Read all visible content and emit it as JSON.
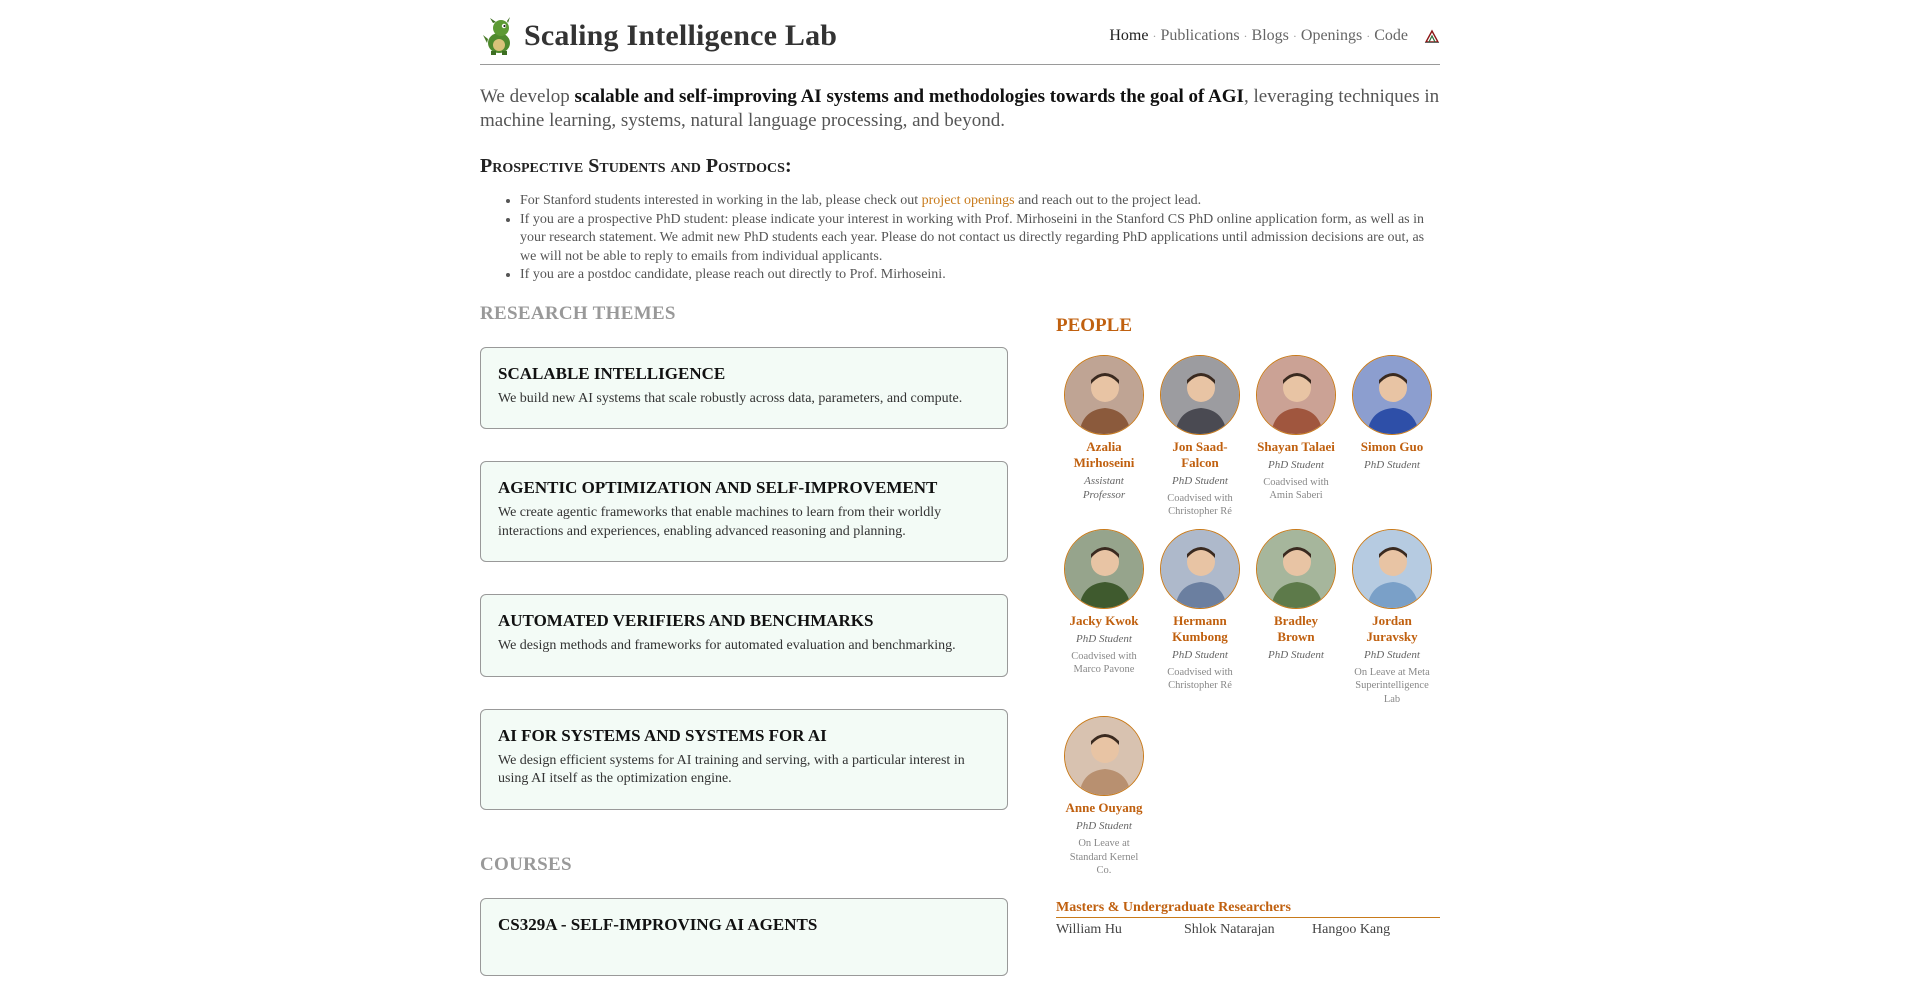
{
  "header": {
    "title": "Scaling Intelligence Lab",
    "logo_icon": "dragon-logo-icon",
    "nav": [
      {
        "label": "Home",
        "active": true
      },
      {
        "label": "Publications",
        "active": false
      },
      {
        "label": "Blogs",
        "active": false
      },
      {
        "label": "Openings",
        "active": false
      },
      {
        "label": "Code",
        "active": false
      }
    ],
    "nav_separator": "·",
    "nav_extra_icon": "stanford-tree-icon"
  },
  "intro": {
    "prefix": "We develop ",
    "emphasis": "scalable and self-improving AI systems and methodologies towards the goal of AGI",
    "suffix": ", leveraging techniques in machine learning, systems, natural language processing, and beyond."
  },
  "prospective": {
    "title": "Prospective Students and Postdocs:",
    "items": [
      {
        "before": "For Stanford students interested in working in the lab, please check out ",
        "link": "project openings",
        "after": " and reach out to the project lead."
      },
      {
        "text": "If you are a prospective PhD student: please indicate your interest in working with Prof. Mirhoseini in the Stanford CS PhD online application form, as well as in your research statement. We admit new PhD students each year. Please do not contact us directly regarding PhD applications until admission decisions are out, as we will not be able to reply to emails from individual applicants."
      },
      {
        "text": "If you are a postdoc candidate, please reach out directly to Prof. Mirhoseini."
      }
    ]
  },
  "research": {
    "heading": "Research Themes",
    "themes": [
      {
        "title": "Scalable Intelligence",
        "desc": "We build new AI systems that scale robustly across data, parameters, and compute."
      },
      {
        "title": "Agentic Optimization and Self-Improvement",
        "desc": "We create agentic frameworks that enable machines to learn from their worldly interactions and experiences, enabling advanced reasoning and planning."
      },
      {
        "title": "Automated Verifiers and Benchmarks",
        "desc": "We design methods and frameworks for automated evaluation and benchmarking."
      },
      {
        "title": "AI for Systems and Systems for AI",
        "desc": "We design efficient systems for AI training and serving, with a particular interest in using AI itself as the optimization engine."
      }
    ]
  },
  "courses": {
    "heading": "Courses",
    "items": [
      {
        "title": "CS329A - Self-Improving AI Agents"
      }
    ]
  },
  "people": {
    "heading": "People",
    "members": [
      {
        "name": "Azalia Mirhoseini",
        "role": "Assistant Professor",
        "note": "",
        "color": "#8b5a3c"
      },
      {
        "name": "Jon Saad-Falcon",
        "role": "PhD Student",
        "note": "Coadvised with Christopher Ré",
        "color": "#4a4a52"
      },
      {
        "name": "Shayan Talaei",
        "role": "PhD Student",
        "note": "Coadvised with Amin Saberi",
        "color": "#a0563e"
      },
      {
        "name": "Simon Guo",
        "role": "PhD Student",
        "note": "",
        "color": "#2e4fa8"
      },
      {
        "name": "Jacky Kwok",
        "role": "PhD Student",
        "note": "Coadvised with Marco Pavone",
        "color": "#3f5a2e"
      },
      {
        "name": "Hermann Kumbong",
        "role": "PhD Student",
        "note": "Coadvised with Christopher Ré",
        "color": "#6b7fa0"
      },
      {
        "name": "Bradley Brown",
        "role": "PhD Student",
        "note": "",
        "color": "#5d7a4a"
      },
      {
        "name": "Jordan Juravsky",
        "role": "PhD Student",
        "note": "On Leave at Meta Superintelligence Lab",
        "color": "#7aa0c8"
      },
      {
        "name": "Anne Ouyang",
        "role": "PhD Student",
        "note": "On Leave at Standard Kernel Co.",
        "color": "#b89070"
      }
    ],
    "masters_heading": "Masters & Undergraduate Researchers",
    "masters": [
      "William Hu",
      "Shlok Natarajan",
      "Hangoo Kang"
    ]
  },
  "colors": {
    "accent": "#c0600f",
    "link": "#c87a1a",
    "card_bg": "#f3fbf6",
    "muted_heading": "#999999"
  }
}
